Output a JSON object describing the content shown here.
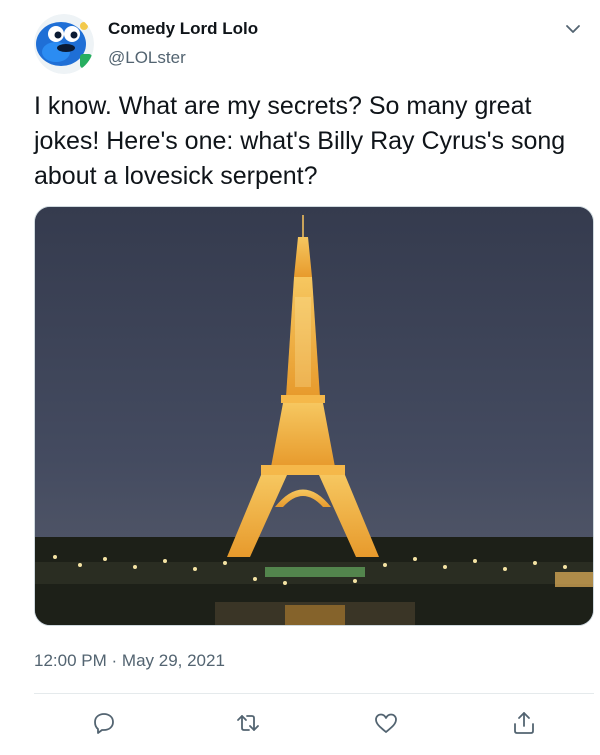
{
  "tweet": {
    "author_name": "Comedy Lord Lolo",
    "author_handle": "@LOLster",
    "text": "I know. What are my secrets? So many great jokes! Here's one: what's Billy Ray Cyrus's song about a lovesick serpent?",
    "time": "12:00 PM",
    "separator": "·",
    "date": "May 29, 2021"
  },
  "icons": {
    "more": "chevron-down-icon",
    "reply": "reply-icon",
    "retweet": "retweet-icon",
    "like": "heart-icon",
    "share": "share-icon"
  },
  "colors": {
    "text_primary": "#0f1419",
    "text_secondary": "#536471",
    "icon_gray": "#536471",
    "divider": "#e5eaec"
  }
}
